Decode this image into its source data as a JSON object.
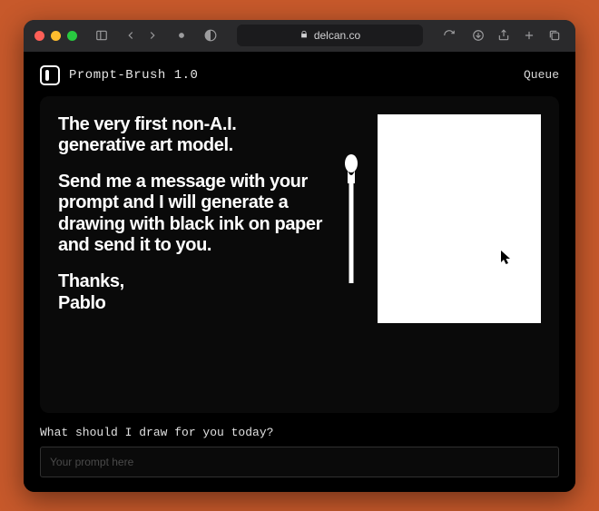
{
  "browser": {
    "url": "delcan.co"
  },
  "app": {
    "title": "Prompt-Brush 1.0",
    "queue_label": "Queue"
  },
  "hero": {
    "p1": "The very first non-A.I. generative art model.",
    "p2": "Send me a message with your prompt and I will generate a drawing with black ink on paper and send it to you.",
    "signoff_thanks": "Thanks,",
    "signoff_name": "Pablo"
  },
  "prompt": {
    "label": "What should I draw for you today?",
    "placeholder": "Your prompt here",
    "value": ""
  }
}
